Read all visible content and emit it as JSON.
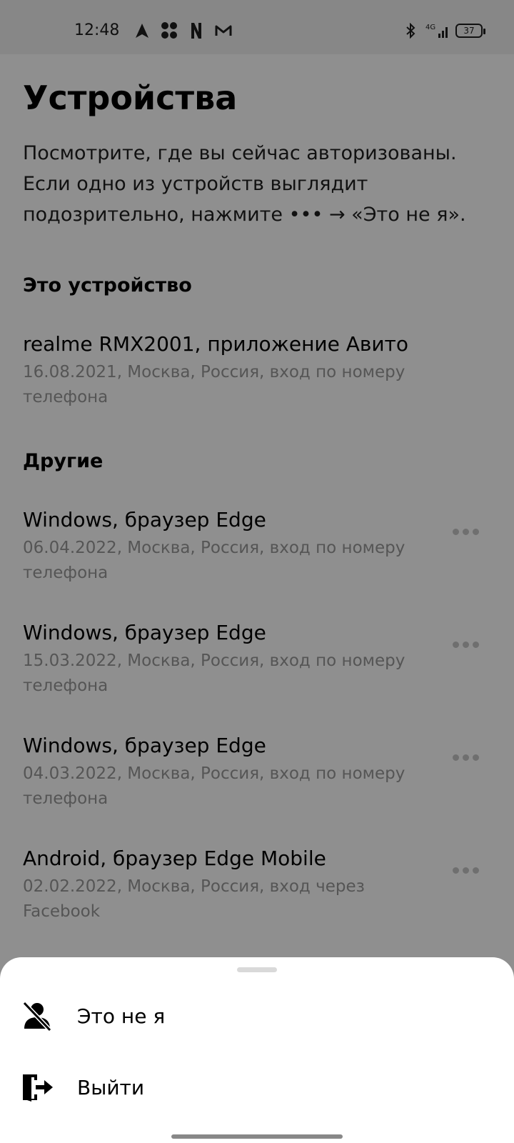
{
  "status_bar": {
    "time": "12:48",
    "battery": "37",
    "network": "4G",
    "icons_left": [
      "navigation-arrow-icon",
      "paw-icon",
      "n-app-icon",
      "m-app-icon"
    ],
    "icons_right": [
      "bluetooth-icon",
      "signal-4g-icon",
      "battery-icon"
    ]
  },
  "page": {
    "title": "Устройства",
    "description": "Посмотрите, где вы сейчас авторизованы. Если одно из устройств выглядит подозрительно, нажмите ••• → «Это не я»."
  },
  "current_section": {
    "title": "Это устройство",
    "device": {
      "name": "realme RMX2001, приложение Авито",
      "meta": "16.08.2021, Москва, Россия, вход по номеру телефона"
    }
  },
  "other_section": {
    "title": "Другие",
    "devices": [
      {
        "name": "Windows, браузер Edge",
        "meta": "06.04.2022, Москва, Россия, вход по номеру телефона"
      },
      {
        "name": "Windows, браузер Edge",
        "meta": "15.03.2022, Москва, Россия, вход по номеру телефона"
      },
      {
        "name": "Windows, браузер Edge",
        "meta": "04.03.2022, Москва, Россия, вход по номеру телефона"
      },
      {
        "name": "Android, браузер Edge Mobile",
        "meta": "02.02.2022, Москва, Россия, вход через Facebook"
      }
    ]
  },
  "sheet": {
    "items": [
      {
        "label": "Это не я",
        "icon": "user-crossed-icon"
      },
      {
        "label": "Выйти",
        "icon": "logout-door-icon"
      }
    ]
  },
  "colors": {
    "overlay_background": "#8f8f8f",
    "status_bar": "#878787",
    "sheet_background": "#ffffff",
    "meta_text": "#555555"
  }
}
